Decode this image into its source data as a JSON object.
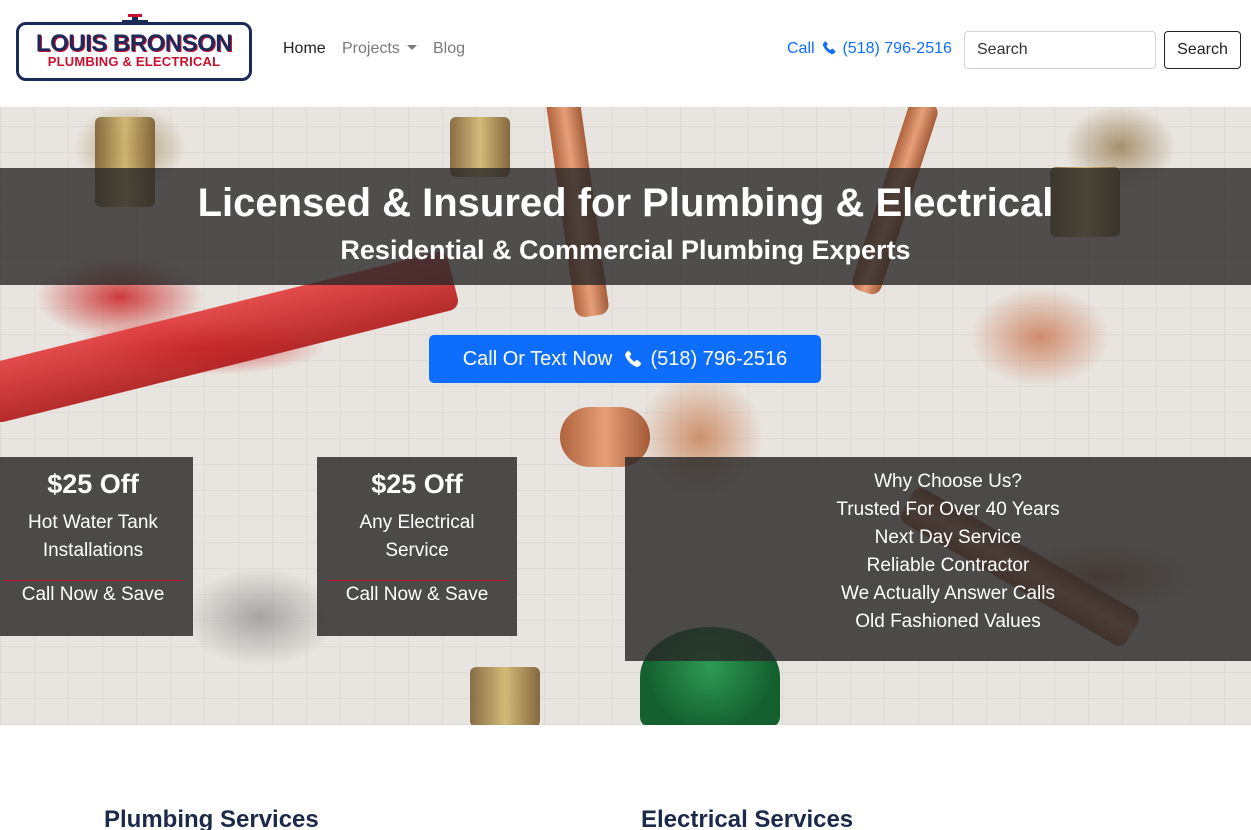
{
  "brand": {
    "line1": "LOUIS BRONSON",
    "line2": "PLUMBING & ELECTRICAL"
  },
  "nav": {
    "items": [
      {
        "label": "Home",
        "active": true
      },
      {
        "label": "Projects",
        "dropdown": true
      },
      {
        "label": "Blog"
      }
    ],
    "call_label": "Call",
    "call_phone": "(518) 796-2516",
    "search_placeholder": "Search",
    "search_button": "Search"
  },
  "hero": {
    "title": "Licensed & Insured for Plumbing & Electrical",
    "subtitle": "Residential & Commercial Plumbing Experts",
    "cta_label": "Call Or Text Now",
    "cta_phone": "(518) 796-2516",
    "offers": [
      {
        "price": "$25 Off",
        "desc": "Hot Water Tank Installations",
        "action": "Call Now & Save"
      },
      {
        "price": "$25 Off",
        "desc": "Any Electrical Service",
        "action": "Call Now & Save"
      }
    ],
    "why": {
      "title": "Why Choose Us?",
      "items": [
        "Trusted For Over 40 Years",
        "Next Day Service",
        "Reliable Contractor",
        "We Actually Answer Calls",
        "Old Fashioned Values"
      ]
    }
  },
  "sections": {
    "plumbing": "Plumbing Services",
    "electrical": "Electrical Services"
  },
  "colors": {
    "primary": "#0d6efd",
    "brand_navy": "#1c2a5a",
    "brand_red": "#c8102e"
  },
  "icons": {
    "phone": "phone-icon"
  }
}
